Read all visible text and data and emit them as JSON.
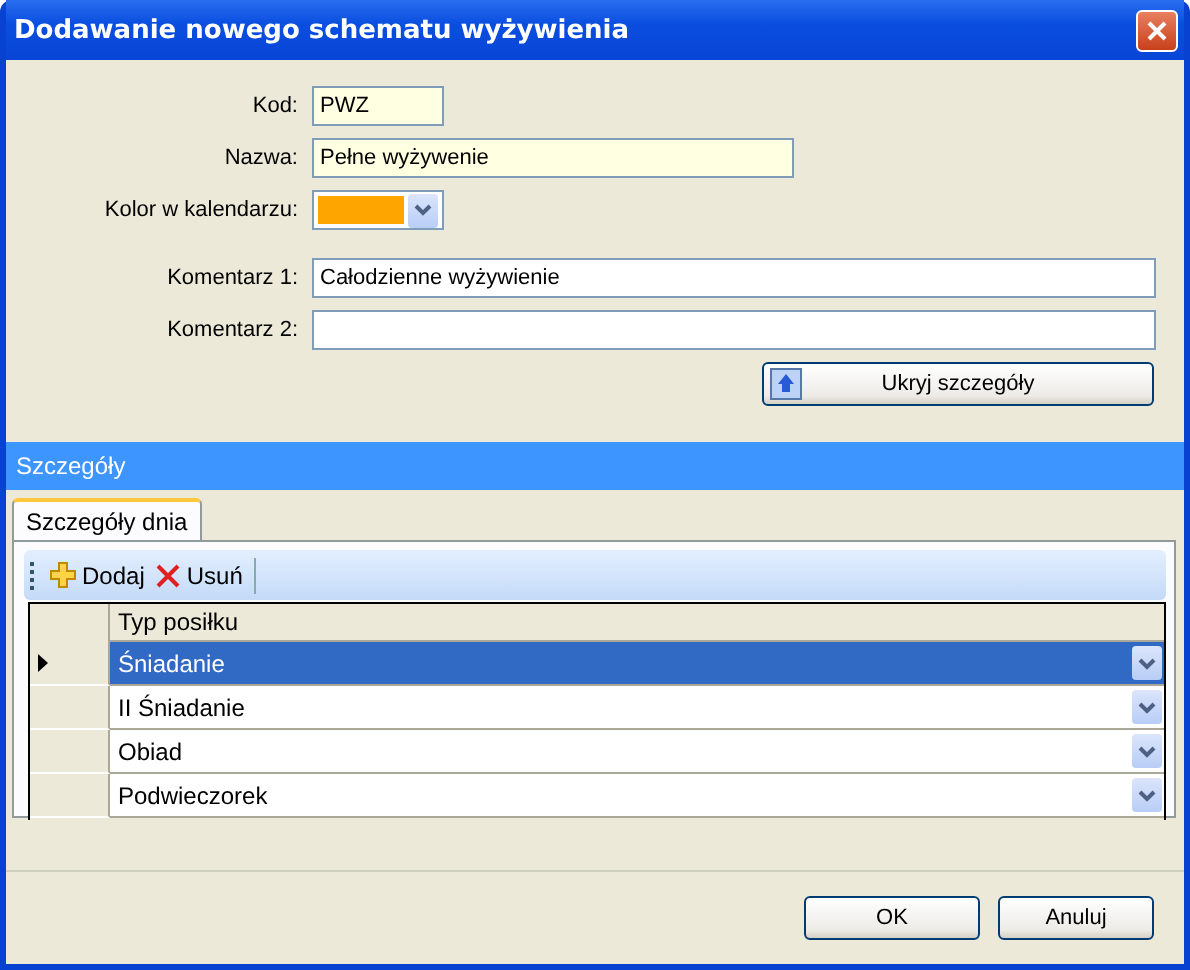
{
  "window": {
    "title": "Dodawanie nowego schematu wyżywienia"
  },
  "fields": [
    {
      "kind": "short",
      "label": "Kod:",
      "value": "PWZ"
    },
    {
      "kind": "medium",
      "label": "Nazwa:",
      "value": "Pełne wyżywenie"
    },
    {
      "kind": "color",
      "label": "Kolor w kalendarzu:",
      "color": "#ffa500"
    },
    {
      "kind": "wide",
      "label": "Komentarz 1:",
      "value": "Całodzienne wyżywienie"
    },
    {
      "kind": "wide",
      "label": "Komentarz 2:"
    }
  ],
  "toggle_button": "Ukryj szczegóły",
  "section": {
    "title": "Szczegóły"
  },
  "tabs": [
    {
      "label": "Szczegóły dnia",
      "selected": true
    }
  ],
  "toolbar": [
    "Dodaj",
    "Usuń"
  ],
  "table": {
    "columns": [
      "Typ posiłku"
    ],
    "rows": [
      {
        "value": "Śniadanie",
        "selected": true
      },
      {
        "value": "II Śniadanie",
        "selected": false
      },
      {
        "value": "Obiad",
        "selected": false
      },
      {
        "value": "Podwieczorek",
        "selected": false
      }
    ]
  },
  "buttons": [
    "OK",
    "Anuluj"
  ]
}
